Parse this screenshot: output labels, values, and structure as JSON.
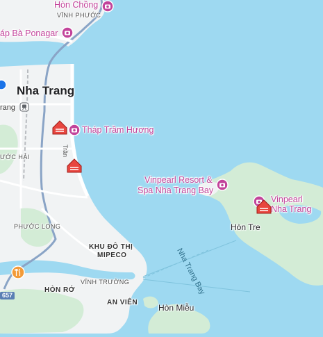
{
  "map": {
    "city_label": "Nha Trang",
    "poi_labels": {
      "hon_chong": "Hòn Chồng",
      "thap_ba": "áp Bà Ponagar",
      "thap_tram_huong": "Tháp Trầm Hương",
      "vinpearl_resort_line1": "Vinpearl Resort &",
      "vinpearl_resort_line2": "Spa Nha Trang Bay",
      "vinpearl_line1": "Vinpearl",
      "vinpearl_line2": "Nha Trang"
    },
    "district_labels": {
      "vinh_phuoc": "VĨNH PHƯỚC",
      "phuoc_hai": "ƯỚC HẢI",
      "phuoc_long": "PHƯỚC LONG",
      "khu_do_thi_1": "KHU ĐÔ THỊ",
      "khu_do_thi_2": "MIPECO",
      "vinh_truong": "VĨNH TRƯỜNG",
      "an_vien": "AN VIÊN",
      "hon_ro": "HÒN RỚ"
    },
    "island_labels": {
      "hon_tre": "Hòn Tre",
      "hon_mieu": "Hòn Miễu"
    },
    "water_label": "Nha Trang Bay",
    "street_label": "Trần",
    "station_label": "rang",
    "road_badge": "657",
    "colors": {
      "water": "#9ed9f1",
      "land": "#f1f3f4",
      "greenery": "#d3ecd6",
      "poi": "#c2439a",
      "pin": "#e8463f",
      "road": "#ffffff",
      "highway": "#8aa4c6"
    },
    "icons": [
      "camera-attraction-icon",
      "hotel-pin-icon",
      "restaurant-icon",
      "train-station-icon",
      "transit-icon"
    ]
  }
}
